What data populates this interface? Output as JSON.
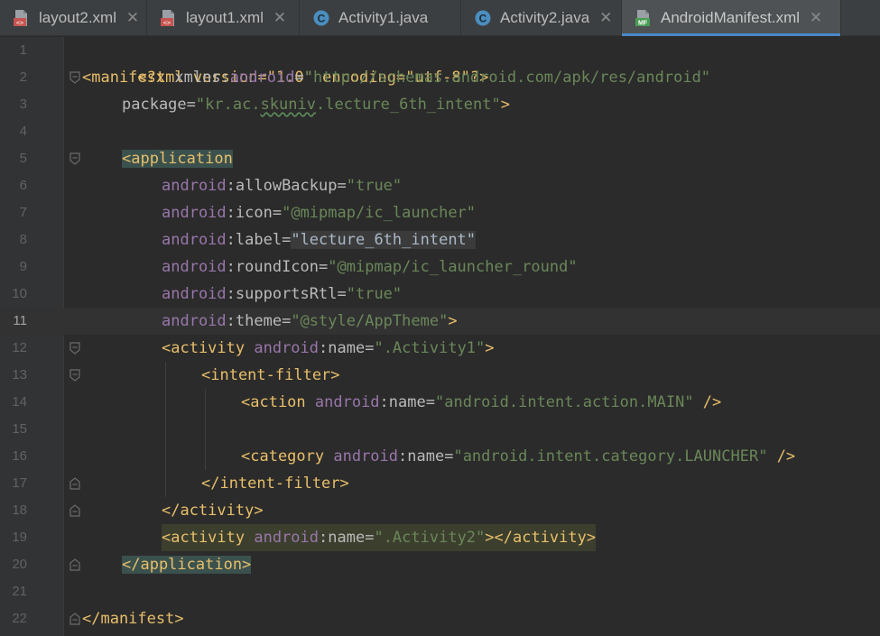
{
  "tabs": [
    {
      "label": "layout2.xml",
      "icon": "layout-xml-icon",
      "active": false
    },
    {
      "label": "layout1.xml",
      "icon": "layout-xml-icon",
      "active": false
    },
    {
      "label": "Activity1.java",
      "icon": "java-class-icon",
      "active": false
    },
    {
      "label": "Activity2.java",
      "icon": "java-class-icon",
      "active": false
    },
    {
      "label": "AndroidManifest.xml",
      "icon": "manifest-icon",
      "active": true
    }
  ],
  "colors": {
    "background": "#2b2b2b",
    "tag": "#e8bf6a",
    "namespace": "#9876aa",
    "string": "#6a8759",
    "text": "#a9b7c6",
    "active_tab_underline": "#4a88c7"
  },
  "editor": {
    "current_line": 11,
    "line_numbers": [
      "1",
      "2",
      "3",
      "4",
      "5",
      "6",
      "7",
      "8",
      "9",
      "10",
      "11",
      "12",
      "13",
      "14",
      "15",
      "16",
      "17",
      "18",
      "19",
      "20",
      "21",
      "22"
    ],
    "lines": {
      "l1": [
        "<?xml version=\"1.0\" encoding=\"utf-8\"?>"
      ],
      "l2": [
        "<manifest",
        " xmlns",
        ":",
        "android",
        "=",
        "\"http://schemas.android.com/apk/res/android\""
      ],
      "l3": [
        "package",
        "=",
        "\"kr.ac.",
        "skuniv",
        ".lecture_6th_intent\"",
        ">"
      ],
      "l5": [
        "<application"
      ],
      "l6": [
        "android",
        ":allowBackup",
        "=",
        "\"true\""
      ],
      "l7": [
        "android",
        ":icon",
        "=",
        "\"@mipmap/ic_launcher\""
      ],
      "l8": [
        "android",
        ":label",
        "=",
        "\"lecture_6th_intent\""
      ],
      "l9": [
        "android",
        ":roundIcon",
        "=",
        "\"@mipmap/ic_launcher_round\""
      ],
      "l10": [
        "android",
        ":supportsRtl",
        "=",
        "\"true\""
      ],
      "l11": [
        "android",
        ":theme",
        "=",
        "\"@style/AppTheme\"",
        ">"
      ],
      "l12": [
        "<activity",
        " android",
        ":name",
        "=",
        "\".Activity1\"",
        ">"
      ],
      "l13": [
        "<intent-filter>"
      ],
      "l14": [
        "<action",
        " android",
        ":name",
        "=",
        "\"android.intent.action.MAIN\"",
        " />"
      ],
      "l16": [
        "<category",
        " android",
        ":name",
        "=",
        "\"android.intent.category.LAUNCHER\"",
        " />"
      ],
      "l17": [
        "</intent-filter>"
      ],
      "l18": [
        "</activity>"
      ],
      "l19": [
        "<activity",
        " android",
        ":name",
        "=",
        "\".Activity2\"",
        "></activity>"
      ],
      "l20": [
        "</application>"
      ],
      "l22": [
        "</manifest>"
      ]
    }
  }
}
